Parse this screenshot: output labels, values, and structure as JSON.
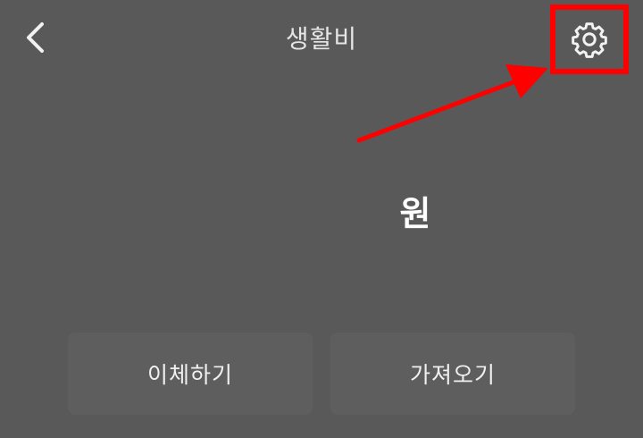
{
  "header": {
    "title": "생활비",
    "back_icon": "chevron-left-icon",
    "settings_icon": "gear-icon"
  },
  "balance": {
    "value": "",
    "unit": "원"
  },
  "actions": {
    "transfer_label": "이체하기",
    "fetch_label": "가져오기"
  },
  "annotation": {
    "highlight_color": "#ff0000"
  },
  "colors": {
    "background": "#595959",
    "button_bg": "#5e5e5e",
    "text": "#ffffff"
  }
}
